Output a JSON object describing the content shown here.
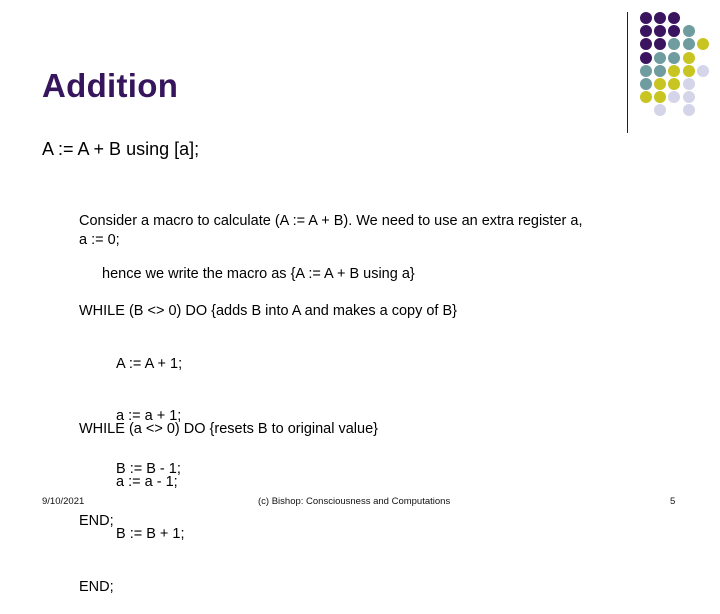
{
  "slide": {
    "title": "Addition",
    "subheading": "A := A + B using [a];",
    "intro": {
      "line1": "Consider a macro to calculate (A := A + B). We need to use an extra register a,",
      "line2": "hence we write the macro as {A := A + B using a}"
    },
    "init": "a := 0;",
    "loop1": {
      "header": "WHILE (B <> 0) DO {adds B into A and makes a copy of B}",
      "body": [
        "A := A + 1;",
        "a := a + 1;",
        "B := B - 1;"
      ],
      "end": "END;"
    },
    "loop2": {
      "header": "WHILE (a <> 0) DO {resets B to original value}",
      "body": [
        "a := a - 1;",
        "B := B + 1;"
      ],
      "end": "END;"
    }
  },
  "footer": {
    "date": "9/10/2021",
    "credit": "(c) Bishop: Consciousness and Computations",
    "page_number": "5"
  },
  "decoration": {
    "colors": {
      "purple": "#3b1460",
      "teal": "#6e9c9f",
      "yellow": "#c8c422",
      "lavender": "#d5d5ea"
    },
    "dot_grid": [
      [
        "purple",
        "purple",
        "purple",
        null,
        null
      ],
      [
        "purple",
        "purple",
        "purple",
        "teal",
        null
      ],
      [
        "purple",
        "purple",
        "teal",
        "teal",
        "yellow"
      ],
      [
        "purple",
        "teal",
        "teal",
        "yellow",
        null
      ],
      [
        "teal",
        "teal",
        "yellow",
        "yellow",
        "lavender"
      ],
      [
        "teal",
        "yellow",
        "yellow",
        "lavender",
        null
      ],
      [
        "yellow",
        "yellow",
        "lavender",
        "lavender",
        null
      ],
      [
        null,
        "lavender",
        null,
        "lavender",
        null
      ]
    ]
  }
}
